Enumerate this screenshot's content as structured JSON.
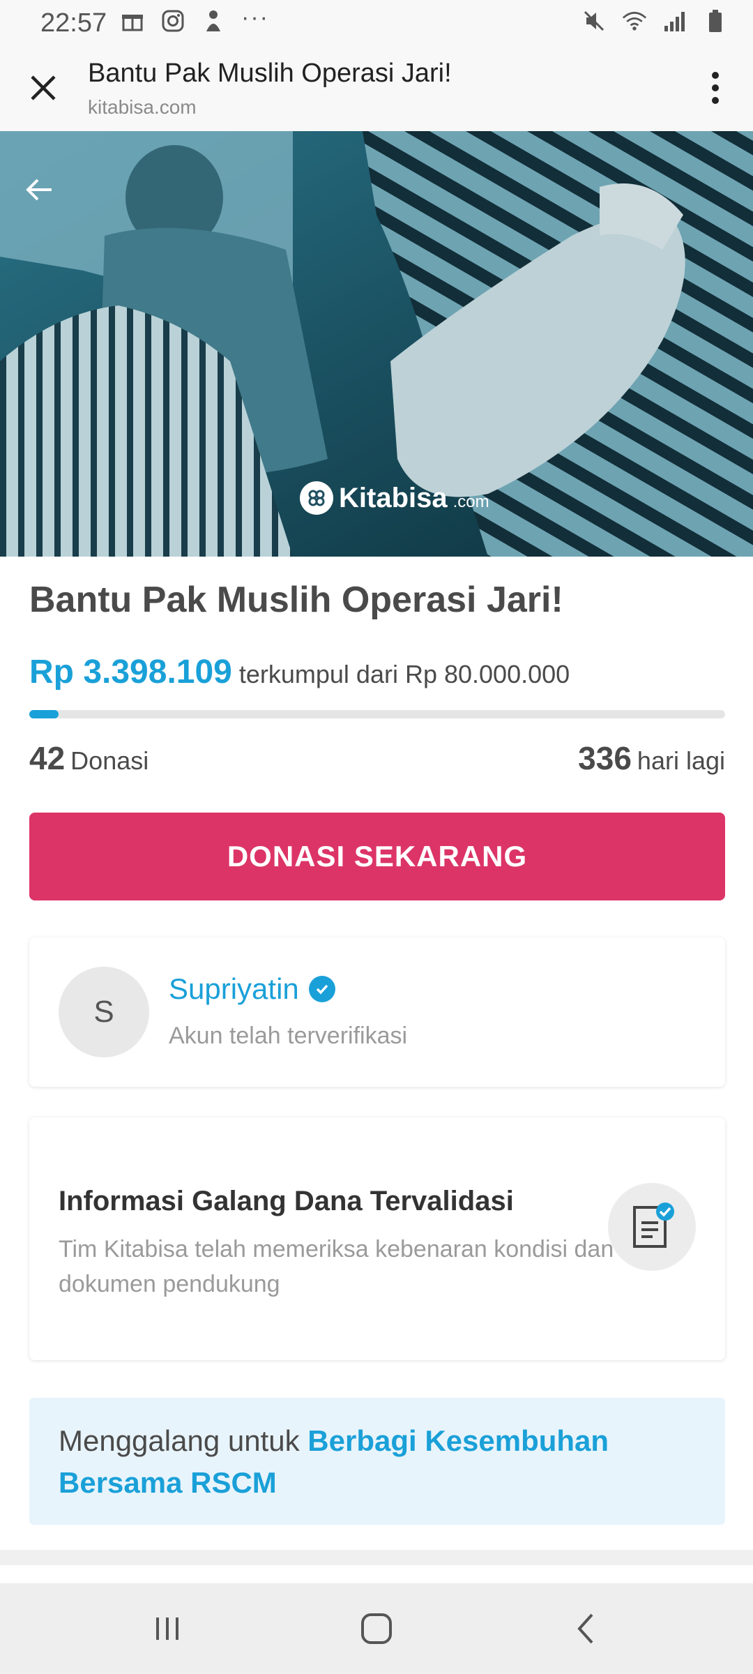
{
  "status_bar": {
    "time": "22:57",
    "left_icons": [
      "gift-icon",
      "instagram-icon",
      "app-icon"
    ],
    "more": "···",
    "right_icons": [
      "mute-icon",
      "wifi-icon",
      "signal-icon",
      "battery-icon"
    ]
  },
  "toolbar": {
    "title": "Bantu Pak Muslih Operasi Jari!",
    "domain": "kitabisa.com"
  },
  "hero": {
    "logo_text": "Kitabisa",
    "logo_suffix": ".com"
  },
  "campaign": {
    "title": "Bantu Pak Muslih Operasi Jari!",
    "raised_amount": "Rp 3.398.109",
    "raised_text": "terkumpul dari Rp 80.000.000",
    "progress_fraction": 0.042,
    "donations_count": "42",
    "donations_label": "Donasi",
    "days_left": "336",
    "days_label": "hari lagi",
    "donate_button": "DONASI SEKARANG"
  },
  "fundraiser": {
    "avatar_initial": "S",
    "name": "Supriyatin",
    "status": "Akun telah terverifikasi"
  },
  "validation": {
    "title": "Informasi Galang Dana Tervalidasi",
    "description": "Tim Kitabisa telah memeriksa kebenaran kondisi dan dokumen pendukung"
  },
  "cause": {
    "prefix": "Menggalang untuk ",
    "link": "Berbagi Kesembuhan Bersama RSCM"
  },
  "colors": {
    "accent_blue": "#1aa0d8",
    "donate_pink": "#dc3467",
    "cause_bg": "#e8f4fb"
  }
}
